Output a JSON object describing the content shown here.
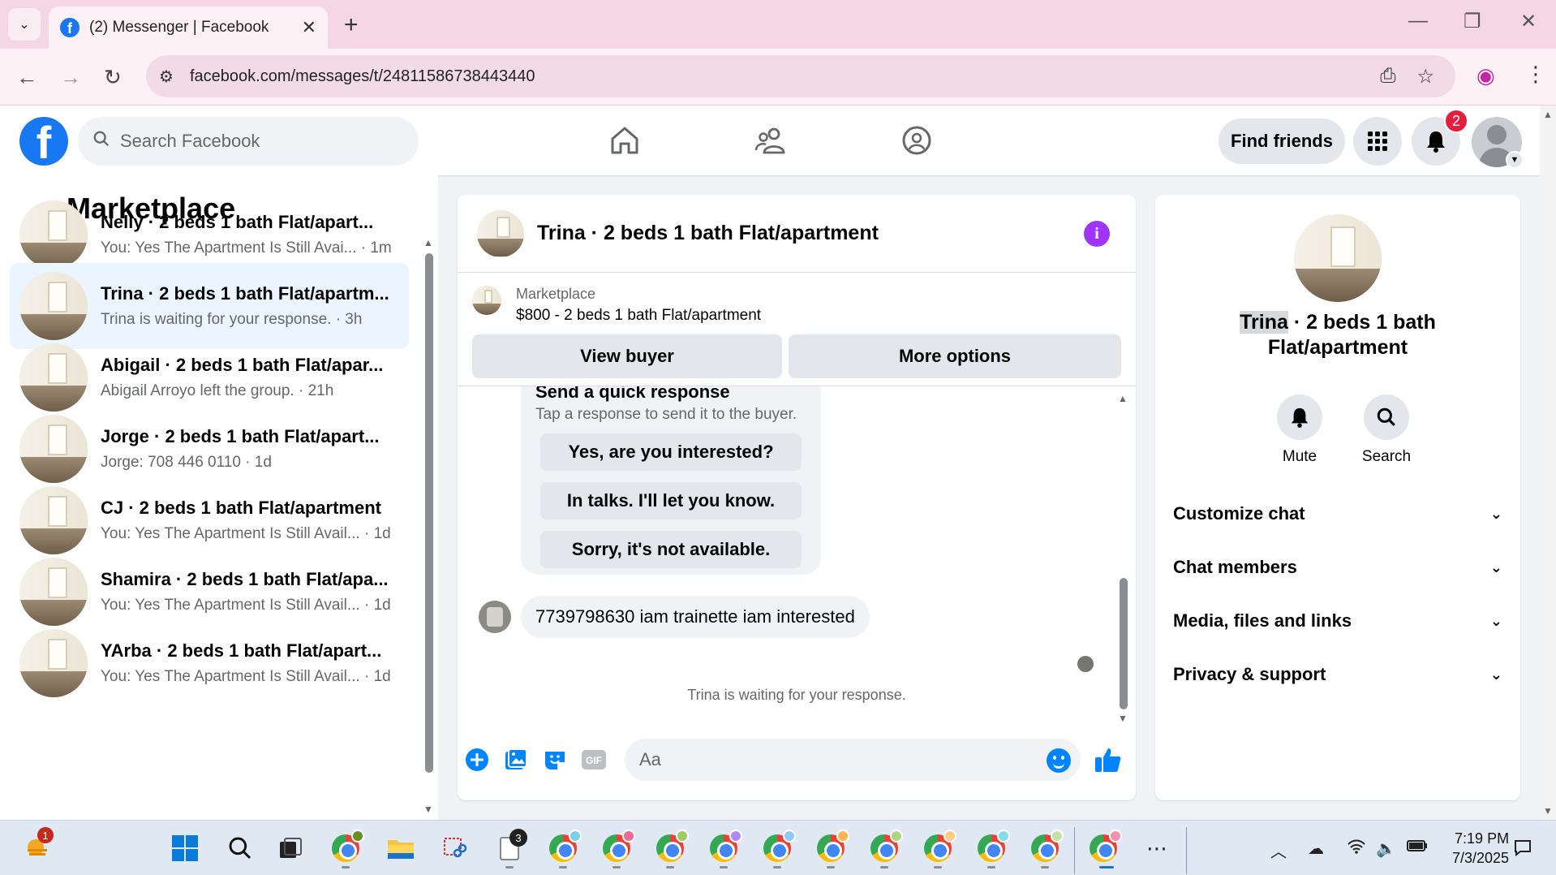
{
  "browser": {
    "tab_title": "(2) Messenger | Facebook",
    "url": "facebook.com/messages/t/24811586738443440",
    "new_tab": "+",
    "tab_close": "✕",
    "minimize": "—",
    "restore": "❐",
    "close": "✕"
  },
  "fb_header": {
    "logo_letter": "f",
    "search_placeholder": "Search Facebook",
    "find_friends": "Find friends",
    "notification_count": "2"
  },
  "left_panel": {
    "title": "Marketplace",
    "conversations": [
      {
        "name": "Nelly · 2 beds 1 bath Flat/apart...",
        "preview": "You: Yes The Apartment Is Still Avai... · 1m",
        "active": false
      },
      {
        "name": "Trina · 2 beds 1 bath Flat/apartm...",
        "preview": "Trina is waiting for your response. · 3h",
        "active": true
      },
      {
        "name": "Abigail · 2 beds 1 bath Flat/apar...",
        "preview": "Abigail Arroyo left the group. · 21h",
        "active": false
      },
      {
        "name": "Jorge · 2 beds 1 bath Flat/apart...",
        "preview": "Jorge: 708 446 0110 · 1d",
        "active": false
      },
      {
        "name": "CJ · 2 beds 1 bath Flat/apartment",
        "preview": "You: Yes The Apartment Is Still Avail... · 1d",
        "active": false
      },
      {
        "name": "Shamira · 2 beds 1 bath Flat/apa...",
        "preview": "You: Yes The Apartment Is Still Avail... · 1d",
        "active": false
      },
      {
        "name": "YArba · 2 beds 1 bath Flat/apart...",
        "preview": "You: Yes The Apartment Is Still Avail... · 1d",
        "active": false
      }
    ]
  },
  "chat": {
    "title": "Trina · 2 beds 1 bath Flat/apartment",
    "info_icon": "i",
    "marketplace_label": "Marketplace",
    "listing": "$800 - 2 beds 1 bath Flat/apartment",
    "view_buyer": "View buyer",
    "more_options": "More options",
    "quick_response_title": "Send a quick response",
    "quick_response_sub": "Tap a response to send it to the buyer.",
    "quick_options": [
      "Yes, are you interested?",
      "In talks. I'll let you know.",
      "Sorry, it's not available."
    ],
    "message": "7739798630 iam trainette iam interested",
    "waiting": "Trina is waiting for your response.",
    "composer_placeholder": "Aa"
  },
  "right_panel": {
    "name_highlight": "Trina",
    "name_rest": " · 2 beds 1 bath Flat/apartment",
    "mute": "Mute",
    "search": "Search",
    "sections": [
      "Customize chat",
      "Chat members",
      "Media, files and links",
      "Privacy & support"
    ]
  },
  "taskbar": {
    "weather_badge": "1",
    "files_badge": "3",
    "time": "7:19 PM",
    "date": "7/3/2025"
  },
  "colors": {
    "fb_blue": "#1877f2",
    "messenger_blue": "#0084ff",
    "info_purple": "#a033ff",
    "active_conversation": "#ebf5ff",
    "notification_red": "#e41e3f"
  }
}
